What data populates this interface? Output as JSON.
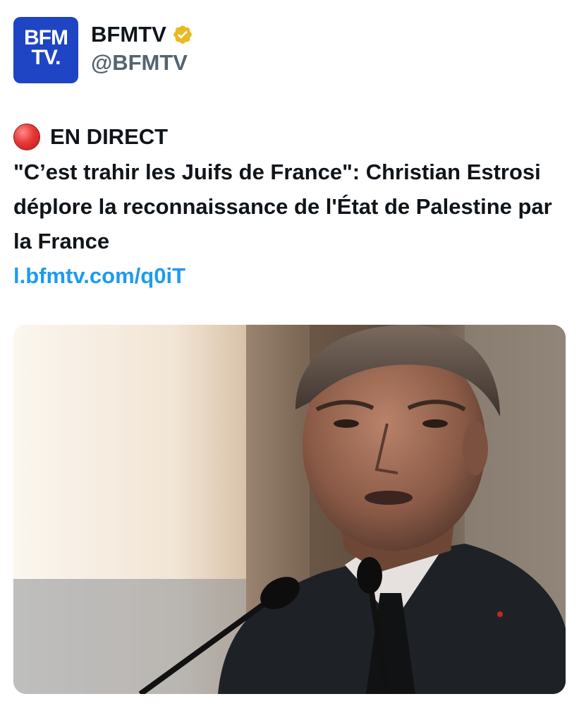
{
  "author": {
    "avatar_text_line1": "BFM",
    "avatar_text_line2": "TV.",
    "display_name": "BFMTV",
    "handle": "@BFMTV",
    "verified_icon": "gold-verified-badge"
  },
  "tweet": {
    "live_label": "EN DIRECT",
    "headline": "\"C’est trahir les Juifs de France\": Christian Estrosi déplore la reconnaissance de l'État de Palestine par la France",
    "link_text": "l.bfmtv.com/q0iT"
  },
  "media": {
    "description_icon": "news-photo"
  },
  "colors": {
    "brand": "#1f44c4",
    "link": "#1d9bf0",
    "verified": "#e8b923",
    "live": "#e53935"
  }
}
